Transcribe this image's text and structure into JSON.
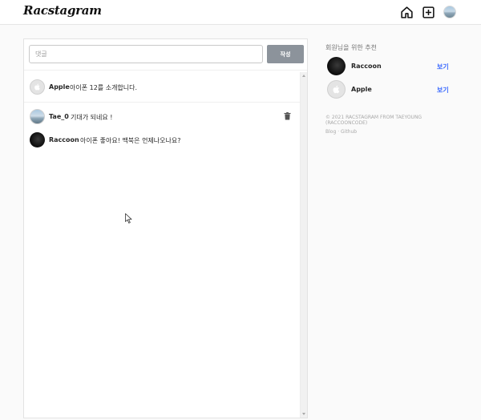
{
  "header": {
    "logo_text": "Racstagram",
    "icons": [
      "home-icon",
      "add-post-icon",
      "profile-avatar"
    ]
  },
  "compose": {
    "placeholder": "댓글",
    "submit_label": "작성"
  },
  "post": {
    "author": "Apple",
    "caption": "아이폰 12를 소개합니다."
  },
  "comments": [
    {
      "author": "Tae_0",
      "text": "기대가 되네요 !",
      "deletable": true
    },
    {
      "author": "Raccoon",
      "text": "아이폰 좋아요! 맥북은 언제나오나요?",
      "deletable": false
    }
  ],
  "sidebar": {
    "title": "회원님을 위한 추천",
    "suggestions": [
      {
        "name": "Raccoon",
        "action": "보기"
      },
      {
        "name": "Apple",
        "action": "보기"
      }
    ],
    "copyright": "© 2021 RACSTAGRAM FROM TAEYOUNG (RACCOONCODE)",
    "footer_links": {
      "blog": "Blog",
      "separator": "·",
      "github": "Github"
    }
  },
  "colors": {
    "link_blue": "#3d6bff",
    "button_gray": "#8c939b",
    "background": "#fafafa"
  }
}
